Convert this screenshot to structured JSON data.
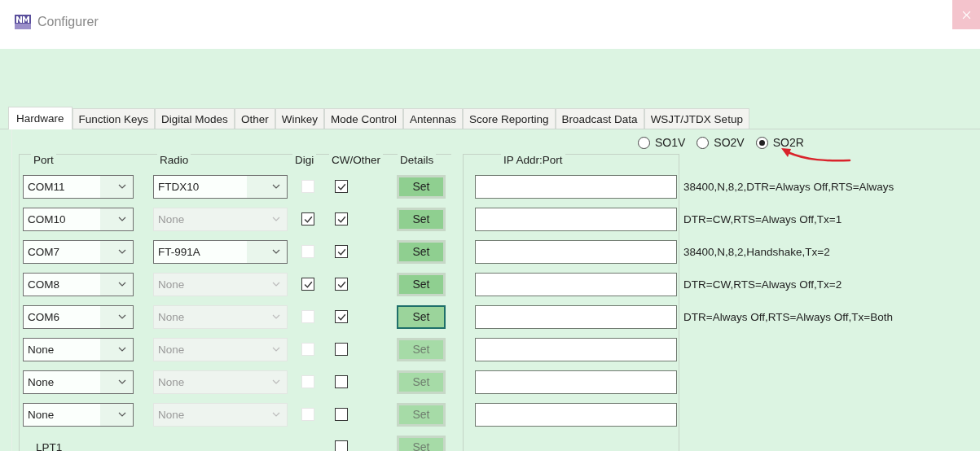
{
  "window": {
    "title": "Configurer"
  },
  "tabs": [
    {
      "label": "Hardware",
      "selected": true
    },
    {
      "label": "Function Keys",
      "selected": false
    },
    {
      "label": "Digital Modes",
      "selected": false
    },
    {
      "label": "Other",
      "selected": false
    },
    {
      "label": "Winkey",
      "selected": false
    },
    {
      "label": "Mode Control",
      "selected": false
    },
    {
      "label": "Antennas",
      "selected": false
    },
    {
      "label": "Score Reporting",
      "selected": false
    },
    {
      "label": "Broadcast Data",
      "selected": false
    },
    {
      "label": "WSJT/JTDX Setup",
      "selected": false
    }
  ],
  "operating_modes": [
    {
      "label": "SO1V",
      "selected": false
    },
    {
      "label": "SO2V",
      "selected": false
    },
    {
      "label": "SO2R",
      "selected": true
    }
  ],
  "columns": {
    "port": "Port",
    "radio": "Radio",
    "digi": "Digi",
    "cw_other": "CW/Other",
    "details": "Details",
    "ip": "IP Addr:Port"
  },
  "rows": [
    {
      "kind": "com",
      "port": "COM11",
      "radio": "FTDX10",
      "radio_disabled": false,
      "digi_checked": false,
      "digi_disabled": true,
      "cw_checked": true,
      "set_label": "Set",
      "set_focused": false,
      "set_disabled": false,
      "details": "38400,N,8,2,DTR=Always Off,RTS=Always"
    },
    {
      "kind": "com",
      "port": "COM10",
      "radio": "None",
      "radio_disabled": true,
      "digi_checked": true,
      "digi_disabled": false,
      "cw_checked": true,
      "set_label": "Set",
      "set_focused": false,
      "set_disabled": false,
      "details": "DTR=CW,RTS=Always Off,Tx=1"
    },
    {
      "kind": "com",
      "port": "COM7",
      "radio": "FT-991A",
      "radio_disabled": false,
      "digi_checked": false,
      "digi_disabled": true,
      "cw_checked": true,
      "set_label": "Set",
      "set_focused": false,
      "set_disabled": false,
      "details": "38400,N,8,2,Handshake,Tx=2"
    },
    {
      "kind": "com",
      "port": "COM8",
      "radio": "None",
      "radio_disabled": true,
      "digi_checked": true,
      "digi_disabled": false,
      "cw_checked": true,
      "set_label": "Set",
      "set_focused": false,
      "set_disabled": false,
      "details": "DTR=CW,RTS=Always Off,Tx=2"
    },
    {
      "kind": "com",
      "port": "COM6",
      "radio": "None",
      "radio_disabled": true,
      "digi_checked": false,
      "digi_disabled": true,
      "cw_checked": true,
      "set_label": "Set",
      "set_focused": true,
      "set_disabled": false,
      "details": "DTR=Always Off,RTS=Always Off,Tx=Both"
    },
    {
      "kind": "com",
      "port": "None",
      "radio": "None",
      "radio_disabled": true,
      "digi_checked": false,
      "digi_disabled": true,
      "cw_checked": false,
      "set_label": "Set",
      "set_focused": false,
      "set_disabled": true
    },
    {
      "kind": "com",
      "port": "None",
      "radio": "None",
      "radio_disabled": true,
      "digi_checked": false,
      "digi_disabled": true,
      "cw_checked": false,
      "set_label": "Set",
      "set_focused": false,
      "set_disabled": true
    },
    {
      "kind": "com",
      "port": "None",
      "radio": "None",
      "radio_disabled": true,
      "digi_checked": false,
      "digi_disabled": true,
      "cw_checked": false,
      "set_label": "Set",
      "set_focused": false,
      "set_disabled": true
    },
    {
      "kind": "lpt",
      "port": "LPT1",
      "cw_checked": false,
      "set_label": "Set",
      "set_focused": false,
      "set_disabled": true
    }
  ]
}
